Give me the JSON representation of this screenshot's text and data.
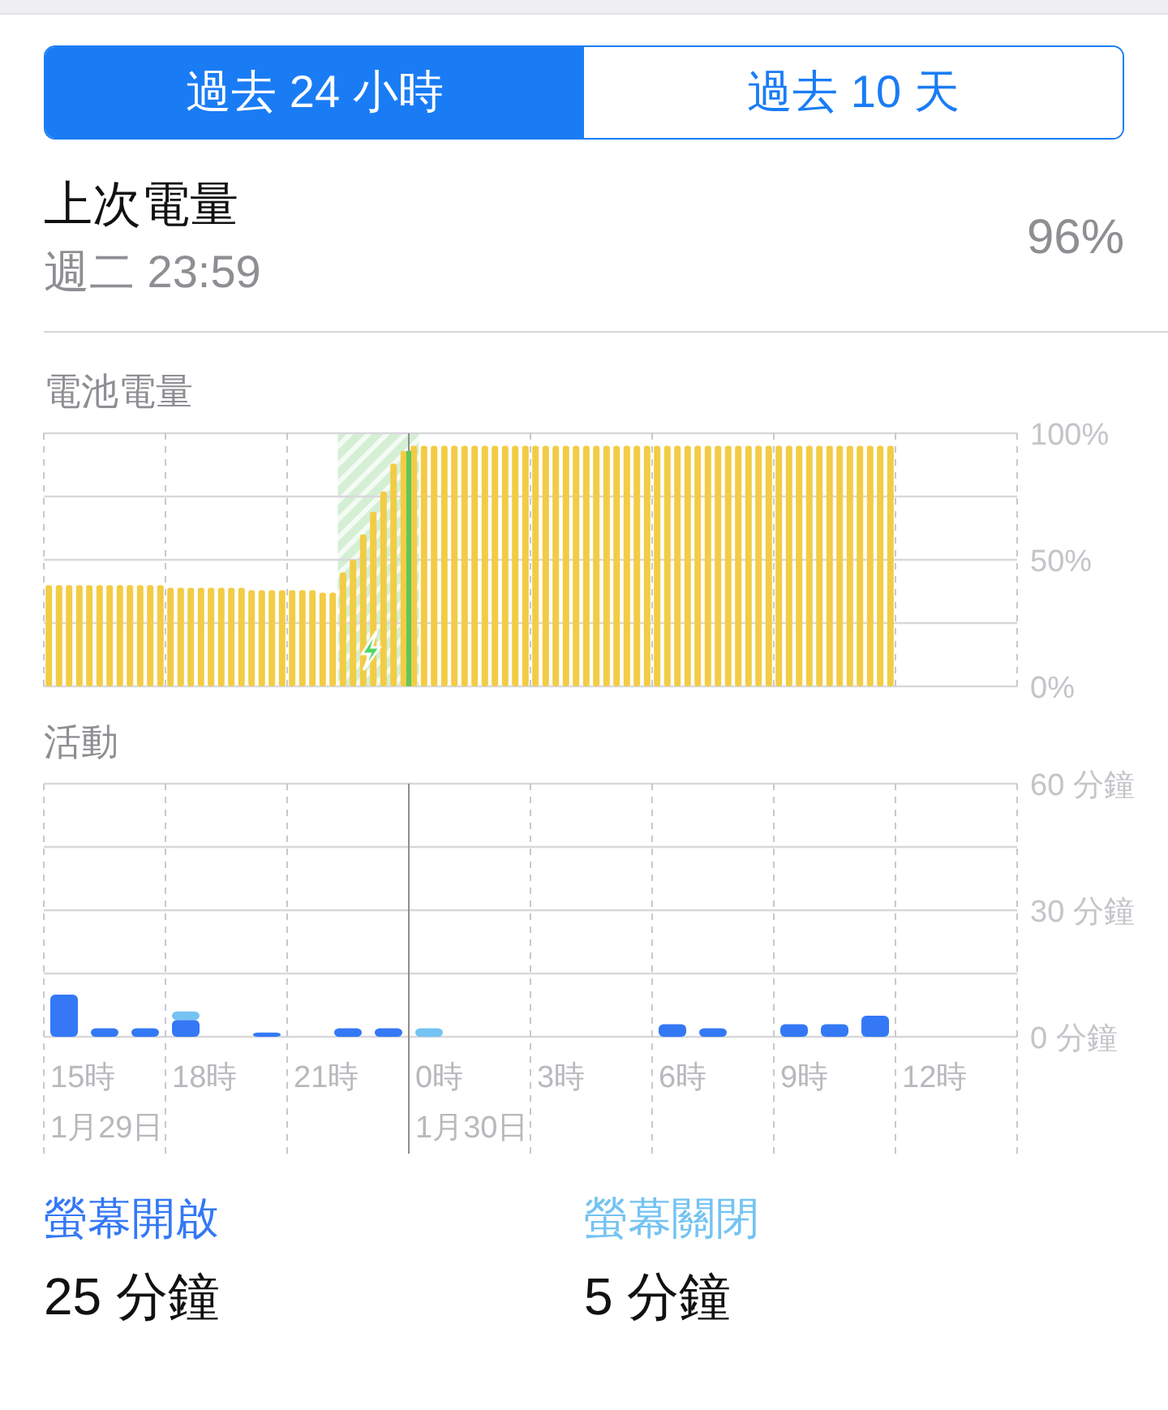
{
  "tabs": [
    {
      "label": "過去 24 小時",
      "selected": true
    },
    {
      "label": "過去 10 天",
      "selected": false
    }
  ],
  "last_charge": {
    "title": "上次電量",
    "time": "週二 23:59",
    "percent": "96%"
  },
  "battery_chart": {
    "title": "電池電量",
    "chart_data": {
      "type": "bar",
      "categories": [
        null,
        null,
        null,
        null,
        null,
        null,
        null,
        null,
        null,
        null,
        null,
        null,
        null,
        null,
        null,
        null,
        null,
        null,
        null,
        null,
        null,
        null,
        null,
        null,
        null,
        null,
        null,
        null,
        null,
        null,
        null,
        null,
        null,
        null,
        null,
        null,
        null,
        null,
        null,
        null,
        null,
        null,
        null,
        null,
        null,
        null,
        null,
        null,
        null,
        null,
        null,
        null,
        null,
        null,
        null,
        null,
        null,
        null,
        null,
        null,
        null,
        null,
        null,
        null,
        null,
        null,
        null,
        null,
        null,
        null,
        null,
        null,
        null,
        null,
        null,
        null,
        null,
        null,
        null,
        null,
        null,
        null,
        null,
        null
      ],
      "series": [
        {
          "color": "#f2cc45",
          "values": [
            40,
            40,
            40,
            40,
            40,
            40,
            40,
            40,
            40,
            40,
            40,
            40,
            39,
            39,
            39,
            39,
            39,
            39,
            39,
            39,
            38,
            38,
            38,
            38,
            38,
            38,
            38,
            37,
            37,
            45,
            50,
            60,
            69,
            77,
            88,
            93,
            95,
            95,
            95,
            95,
            95,
            95,
            95,
            95,
            95,
            95,
            95,
            95,
            95,
            95,
            95,
            95,
            95,
            95,
            95,
            95,
            95,
            95,
            95,
            95,
            95,
            95,
            95,
            95,
            95,
            95,
            95,
            95,
            95,
            95,
            95,
            95,
            95,
            95,
            95,
            95,
            95,
            95,
            95,
            95,
            95,
            95,
            95,
            95
          ]
        }
      ],
      "ylim": [
        0,
        100
      ],
      "yticks": [
        {
          "value": 0,
          "label": "0%"
        },
        {
          "value": 50,
          "label": "50%"
        },
        {
          "value": 100,
          "label": "100%"
        }
      ]
    }
  },
  "activity_chart": {
    "title": "活動",
    "chart_data": {
      "type": "bar",
      "stacked": true,
      "categories": [
        null,
        null,
        null,
        null,
        null,
        null,
        null,
        null,
        null,
        null,
        null,
        null,
        null,
        null,
        null,
        null,
        null,
        null,
        null,
        null,
        null,
        null,
        null,
        null
      ],
      "series": [
        {
          "color": "#3478f6",
          "values": [
            10,
            2,
            2,
            4,
            0,
            1,
            0,
            2,
            2,
            0,
            0,
            0,
            0,
            0,
            0,
            3,
            2,
            0,
            3,
            3,
            5,
            null,
            null,
            null
          ]
        },
        {
          "color": "#74c3f2",
          "values": [
            0,
            0,
            0,
            2,
            0,
            0,
            0,
            0,
            0,
            2,
            0,
            0,
            0,
            0,
            0,
            0,
            0,
            0,
            0,
            0,
            0,
            null,
            null,
            null
          ]
        }
      ],
      "ylim": [
        0,
        60
      ],
      "yticks": [
        {
          "value": 0,
          "label": "0 分鐘"
        },
        {
          "value": 30,
          "label": "30 分鐘"
        },
        {
          "value": 60,
          "label": "60 分鐘"
        }
      ]
    },
    "hour_labels": [
      "15時",
      "18時",
      "21時",
      "0時",
      "3時",
      "6時",
      "9時",
      "12時"
    ],
    "date_labels": [
      "1月29日",
      "1月30日"
    ]
  },
  "stats": [
    {
      "label": "螢幕開啟",
      "color": "#3478f6",
      "value": "25 分鐘"
    },
    {
      "label": "螢幕關閉",
      "color": "#74c3f2",
      "value": "5 分鐘"
    }
  ]
}
